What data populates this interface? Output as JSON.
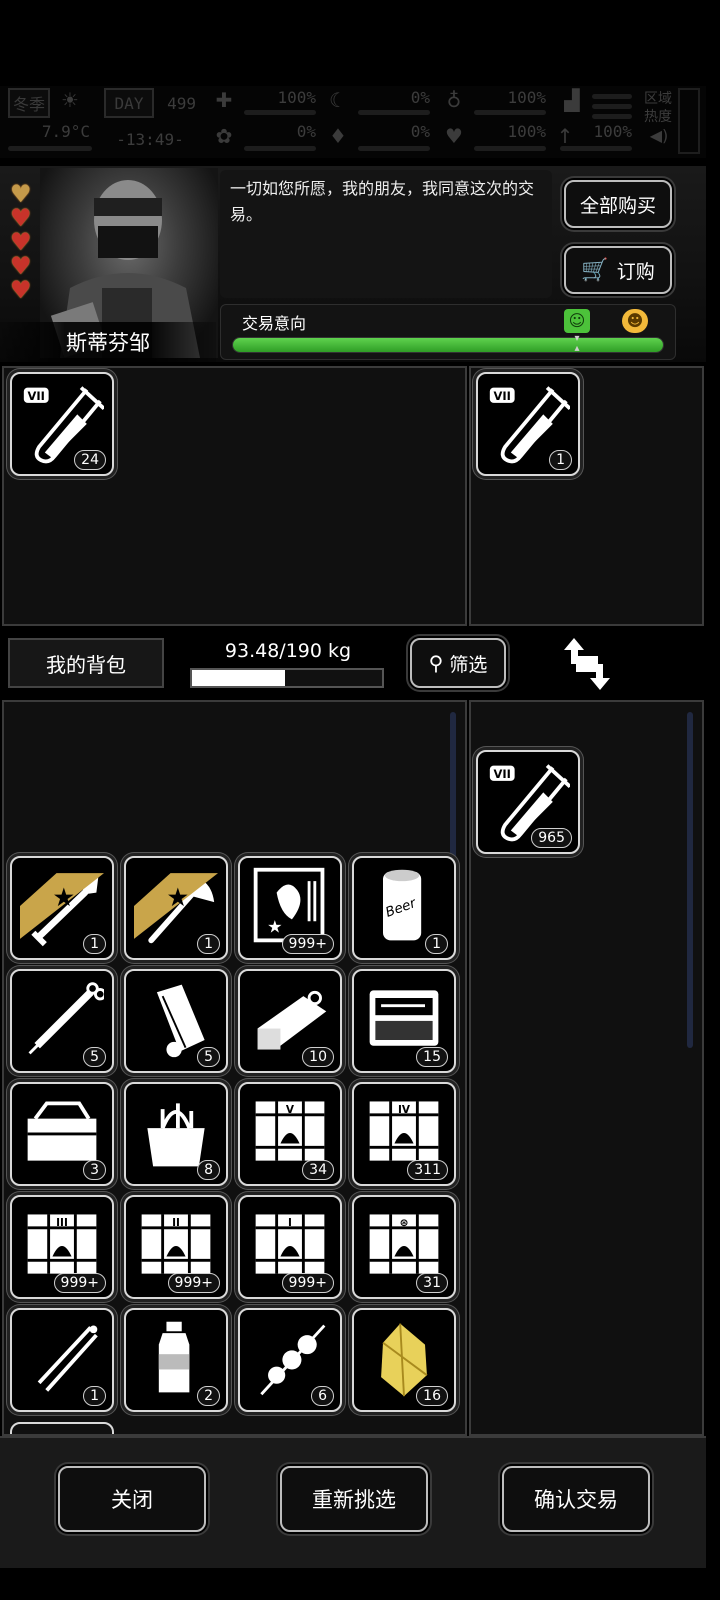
{
  "status": {
    "season": "冬季",
    "temperature": "7.9°C",
    "day_label": "DAY",
    "day": "499",
    "time": "-13:49-",
    "stats": {
      "health": "100%",
      "hunger": "0%",
      "stamina": "100%",
      "bleeding": "0%",
      "thirst": "0%",
      "heart": "100%",
      "upgrade": "100%"
    },
    "zone_heat": "区域\n热度"
  },
  "npc": {
    "name": "斯蒂芬邹",
    "hearts": 5,
    "dialog": "一切如您所愿，我的朋友，我同意这次的交易。"
  },
  "buttons": {
    "buy_all": "全部购买",
    "order": "订购",
    "close": "关闭",
    "reselect": "重新挑选",
    "confirm": "确认交易",
    "filter": "筛选"
  },
  "trade_intent": {
    "label": "交易意向",
    "level": 1.0
  },
  "trader_stock": [
    {
      "item": "vii-test-tube",
      "qty": "24"
    }
  ],
  "trader_offer": [
    {
      "item": "vii-test-tube",
      "qty": "1"
    }
  ],
  "bag": {
    "label": "我的背包",
    "weight": "93.48/190 kg",
    "weight_fraction": 0.492
  },
  "inventory": [
    {
      "item": "shovel",
      "qty": "1",
      "starred": true
    },
    {
      "item": "axe",
      "qty": "1",
      "starred": true
    },
    {
      "item": "zombie-card",
      "qty": "999+"
    },
    {
      "item": "beer-can",
      "qty": "1"
    },
    {
      "item": "syringe",
      "qty": "5"
    },
    {
      "item": "bandage-roll",
      "qty": "5"
    },
    {
      "item": "canned-food",
      "qty": "10"
    },
    {
      "item": "tool-kit",
      "qty": "15"
    },
    {
      "item": "toolbox",
      "qty": "3"
    },
    {
      "item": "tool-bag",
      "qty": "8"
    },
    {
      "item": "crate-v",
      "qty": "34"
    },
    {
      "item": "crate-iv",
      "qty": "311"
    },
    {
      "item": "crate-iii",
      "qty": "999+"
    },
    {
      "item": "crate-ii",
      "qty": "999+"
    },
    {
      "item": "crate-i",
      "qty": "999+"
    },
    {
      "item": "crate-special",
      "qty": "31"
    },
    {
      "item": "tongs",
      "qty": "1"
    },
    {
      "item": "water-bottle",
      "qty": "2"
    },
    {
      "item": "meat-skewer",
      "qty": "6"
    },
    {
      "item": "gold-ore",
      "qty": "16"
    }
  ],
  "my_offer": [
    {
      "item": "vii-test-tube",
      "qty": "965"
    }
  ],
  "colors": {
    "accent_green": "#4cc23a",
    "panel_border": "#3b3b3b"
  }
}
